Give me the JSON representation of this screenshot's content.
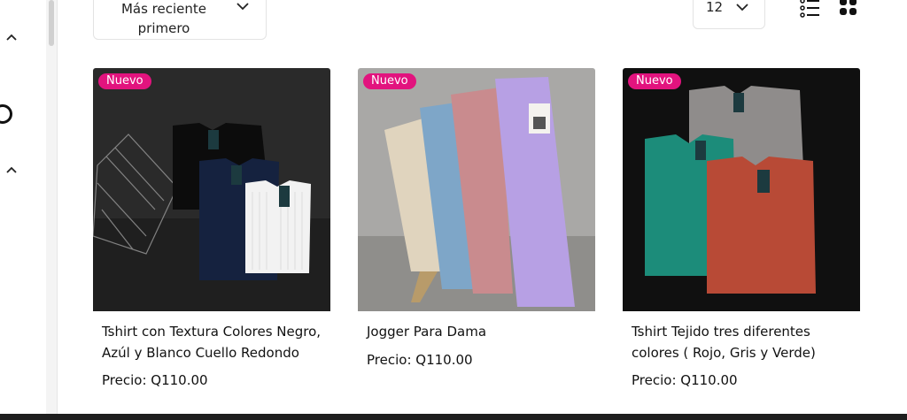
{
  "sort": {
    "label": "Más reciente primero"
  },
  "per_page": {
    "value": "12"
  },
  "view_toggles": {
    "list_icon": "list-view-icon",
    "grid_icon": "grid-view-icon"
  },
  "colors": {
    "badge": "#e2137e",
    "text": "#111111",
    "border": "#e3e3e3"
  },
  "products": [
    {
      "badge": "Nuevo",
      "title": "Tshirt con Textura Colores Negro, Azúl y Blanco Cuello Redondo",
      "price": "Precio: Q110.00"
    },
    {
      "badge": "Nuevo",
      "title": "Jogger Para Dama",
      "price": "Precio: Q110.00"
    },
    {
      "badge": "Nuevo",
      "title": "Tshirt Tejido tres diferentes colores ( Rojo, Gris y Verde)",
      "price": "Precio: Q110.00"
    }
  ]
}
